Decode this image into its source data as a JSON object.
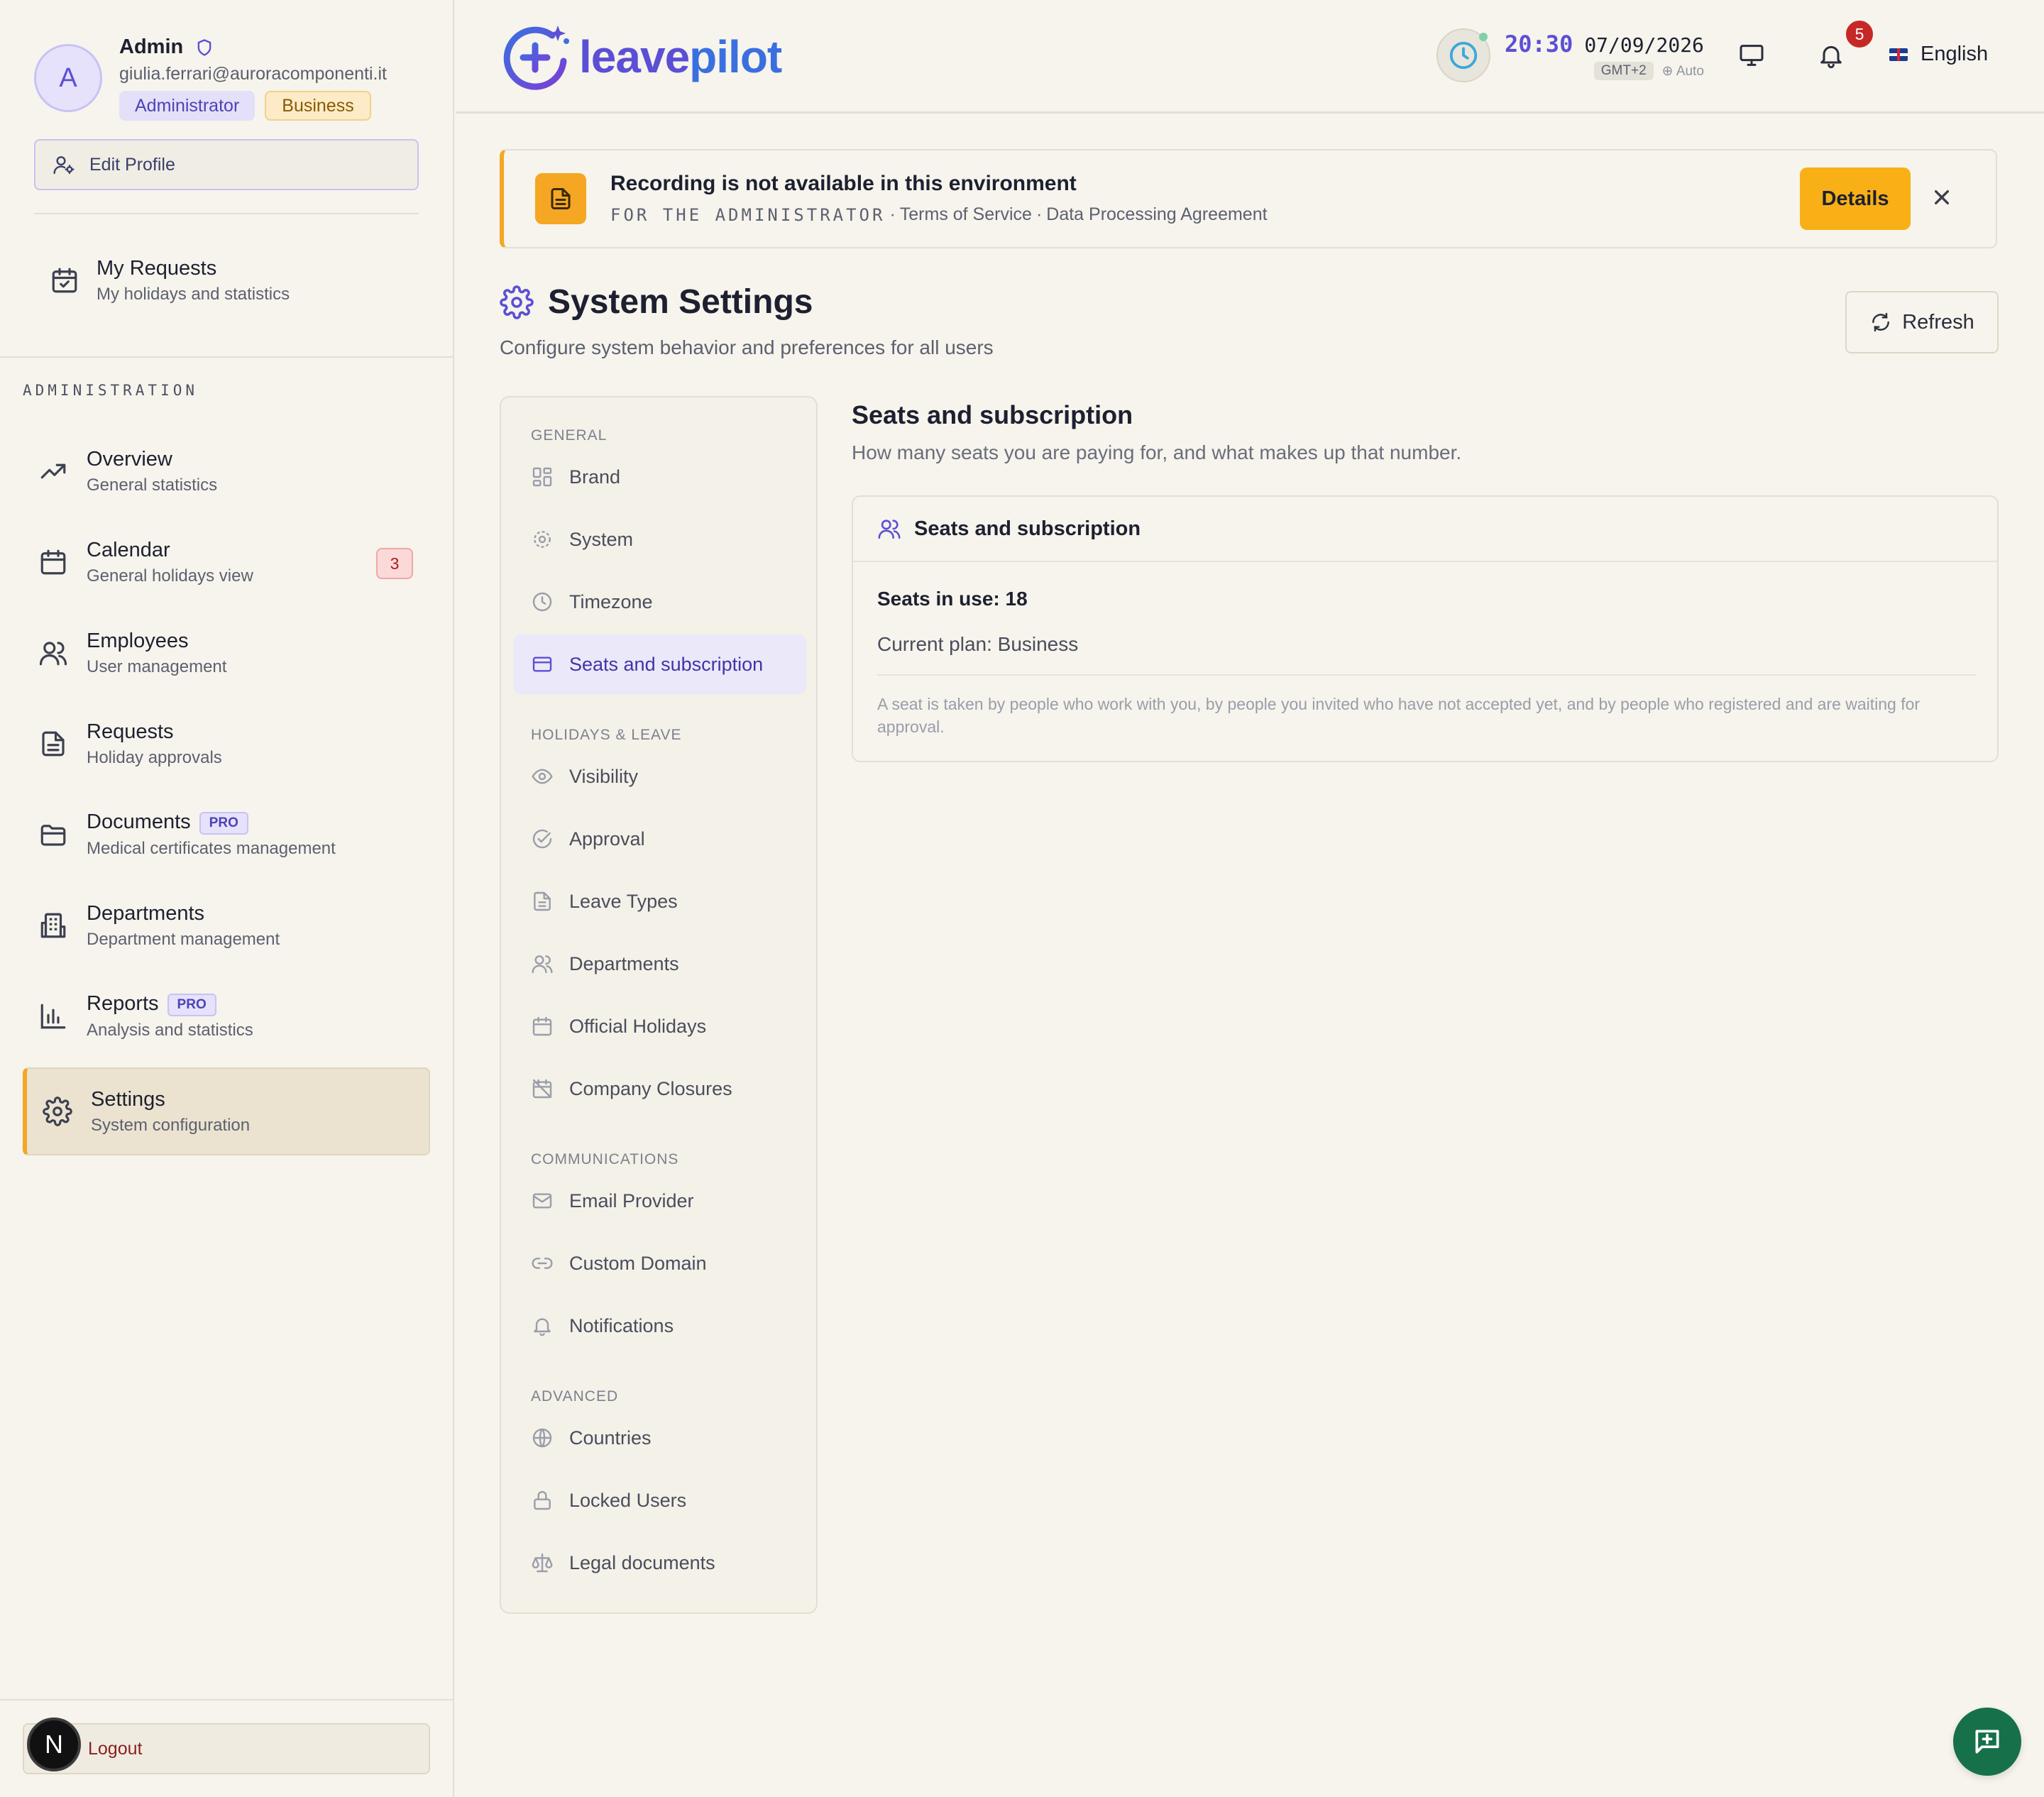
{
  "user": {
    "avatar_initial": "A",
    "name": "Admin",
    "email": "giulia.ferrari@auroracomponenti.it",
    "role_badge": "Administrator",
    "plan_badge": "Business",
    "edit_profile_label": "Edit Profile"
  },
  "my_requests": {
    "title": "My Requests",
    "subtitle": "My holidays and statistics"
  },
  "sidebar": {
    "section_label": "ADMINISTRATION",
    "items": [
      {
        "title": "Overview",
        "subtitle": "General statistics",
        "icon": "trending-up-icon"
      },
      {
        "title": "Calendar",
        "subtitle": "General holidays view",
        "icon": "calendar-icon",
        "count": "3"
      },
      {
        "title": "Employees",
        "subtitle": "User management",
        "icon": "users-icon"
      },
      {
        "title": "Requests",
        "subtitle": "Holiday approvals",
        "icon": "document-icon"
      },
      {
        "title": "Documents",
        "subtitle": "Medical certificates management",
        "icon": "folder-icon",
        "pro": "PRO"
      },
      {
        "title": "Departments",
        "subtitle": "Department management",
        "icon": "building-icon"
      },
      {
        "title": "Reports",
        "subtitle": "Analysis and statistics",
        "icon": "bar-chart-icon",
        "pro": "PRO"
      },
      {
        "title": "Settings",
        "subtitle": "System configuration",
        "icon": "gear-icon",
        "active": true
      }
    ],
    "logout_label": "Logout",
    "n_badge": "N"
  },
  "header": {
    "logo_part1": "leave",
    "logo_part2": "pilot",
    "time": "20:30",
    "date": "07/09/2026",
    "timezone": "GMT+2",
    "timezone_mode": "Auto",
    "notifications_count": "5",
    "language": "English"
  },
  "banner": {
    "title": "Recording is not available in this environment",
    "audience": "FOR THE ADMINISTRATOR",
    "sep": "·",
    "link1": "Terms of Service",
    "link2": "Data Processing Agreement",
    "details_label": "Details"
  },
  "page": {
    "title": "System Settings",
    "subtitle": "Configure system behavior and preferences for all users",
    "refresh_label": "Refresh"
  },
  "settings_nav": {
    "groups": [
      {
        "label": "GENERAL",
        "items": [
          "Brand",
          "System",
          "Timezone",
          "Seats and subscription"
        ]
      },
      {
        "label": "HOLIDAYS & LEAVE",
        "items": [
          "Visibility",
          "Approval",
          "Leave Types",
          "Departments",
          "Official Holidays",
          "Company Closures"
        ]
      },
      {
        "label": "COMMUNICATIONS",
        "items": [
          "Email Provider",
          "Custom Domain",
          "Notifications"
        ]
      },
      {
        "label": "ADVANCED",
        "items": [
          "Countries",
          "Locked Users",
          "Legal documents"
        ]
      }
    ],
    "active_item": "Seats and subscription"
  },
  "seats_section": {
    "title": "Seats and subscription",
    "subtitle": "How many seats you are paying for, and what makes up that number.",
    "card_title": "Seats and subscription",
    "seats_in_use": "Seats in use: 18",
    "current_plan": "Current plan: Business",
    "note": "A seat is taken by people who work with you, by people you invited who have not accepted yet, and by people who registered and are waiting for approval."
  },
  "colors": {
    "accent": "#5b4fd6",
    "warning": "#f5a623",
    "background": "#f6f4ec",
    "danger": "#c62828",
    "chat": "#16704a"
  }
}
